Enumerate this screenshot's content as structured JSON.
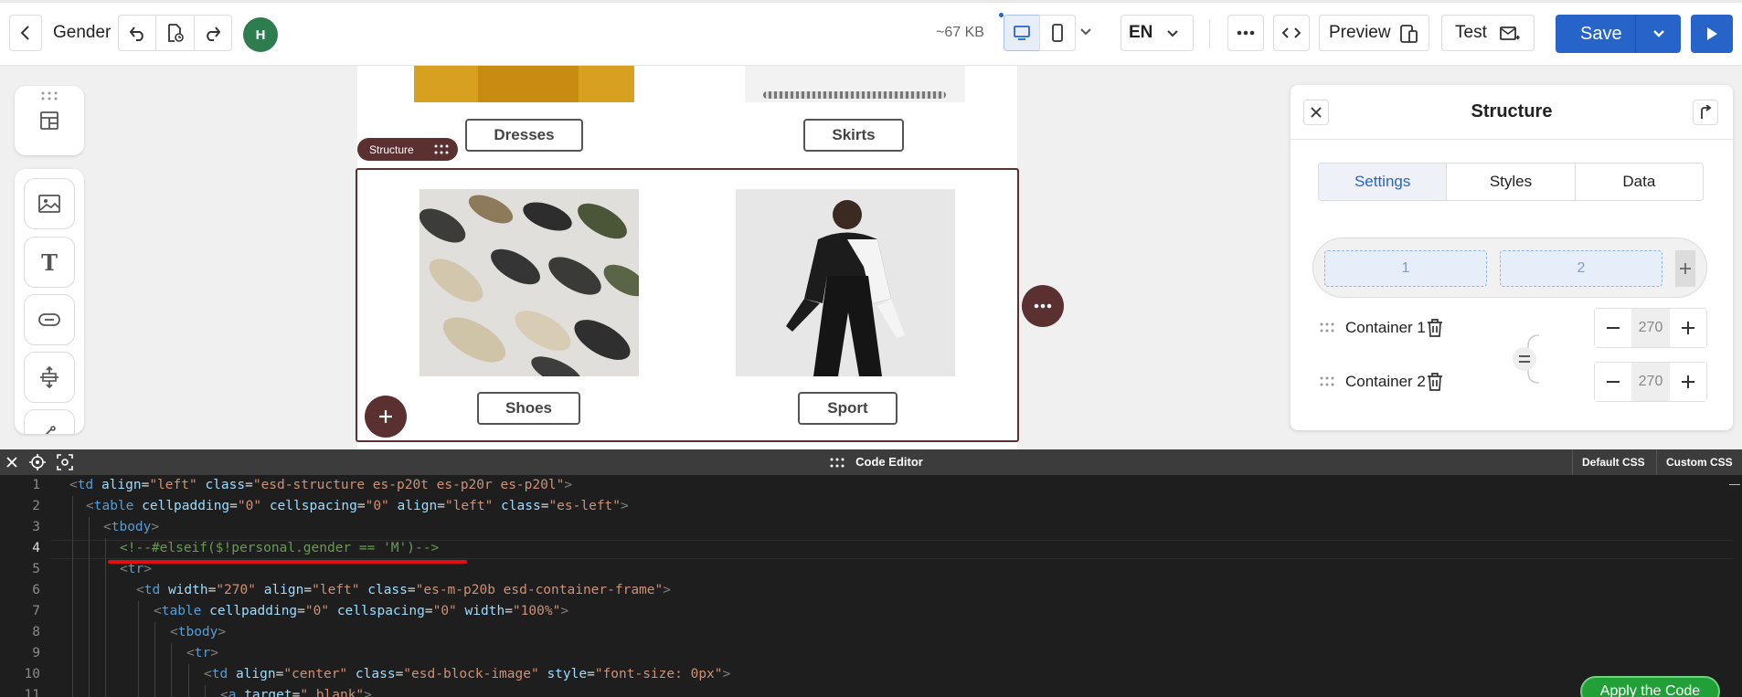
{
  "header": {
    "template_name": "Gender",
    "avatar_initial": "H",
    "size": "~67 KB",
    "language": "EN",
    "preview_label": "Preview",
    "test_label": "Test",
    "save_label": "Save"
  },
  "canvas": {
    "top_buttons": [
      "Dresses",
      "Skirts"
    ],
    "structure_tag": "Structure",
    "bottom_buttons": [
      "Shoes",
      "Sport"
    ]
  },
  "panel": {
    "title": "Structure",
    "tabs": [
      "Settings",
      "Styles",
      "Data"
    ],
    "active_tab": "Settings",
    "columns": [
      "1",
      "2"
    ],
    "containers": [
      {
        "label": "Container 1",
        "value": "270"
      },
      {
        "label": "Container 2",
        "value": "270"
      }
    ]
  },
  "editor": {
    "title": "Code Editor",
    "tabs": [
      "Default CSS",
      "Custom CSS"
    ],
    "apply_label": "Apply the Code",
    "line_numbers": [
      "1",
      "2",
      "3",
      "4",
      "5",
      "6",
      "7",
      "8",
      "9",
      "10",
      "11"
    ]
  },
  "colors": {
    "accent": "#2764c9",
    "structure": "#5b3030",
    "apply": "#21a038",
    "highlight": "#e01010"
  }
}
